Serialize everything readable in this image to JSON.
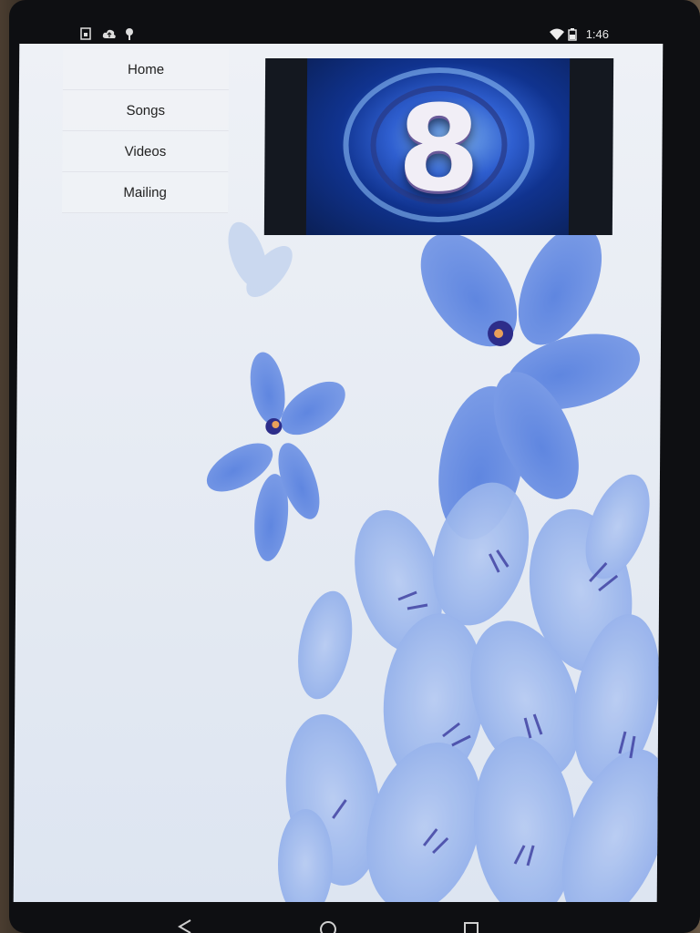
{
  "status_bar": {
    "time": "1:46",
    "left_icons": [
      "sim-card-icon",
      "cloud-upload-icon",
      "usb-icon"
    ],
    "right_icons": [
      "wifi-icon",
      "battery-icon"
    ]
  },
  "menu": {
    "items": [
      {
        "label": "Home"
      },
      {
        "label": "Songs"
      },
      {
        "label": "Videos"
      },
      {
        "label": "Mailing"
      }
    ]
  },
  "video": {
    "overlay_text": "8"
  },
  "nav_bar": {
    "buttons": [
      "back-icon",
      "home-icon",
      "recents-icon"
    ]
  },
  "colors": {
    "flower_blue": "#6f90e0",
    "flower_light": "#a9c2f0",
    "background": "#e6ebf3"
  }
}
